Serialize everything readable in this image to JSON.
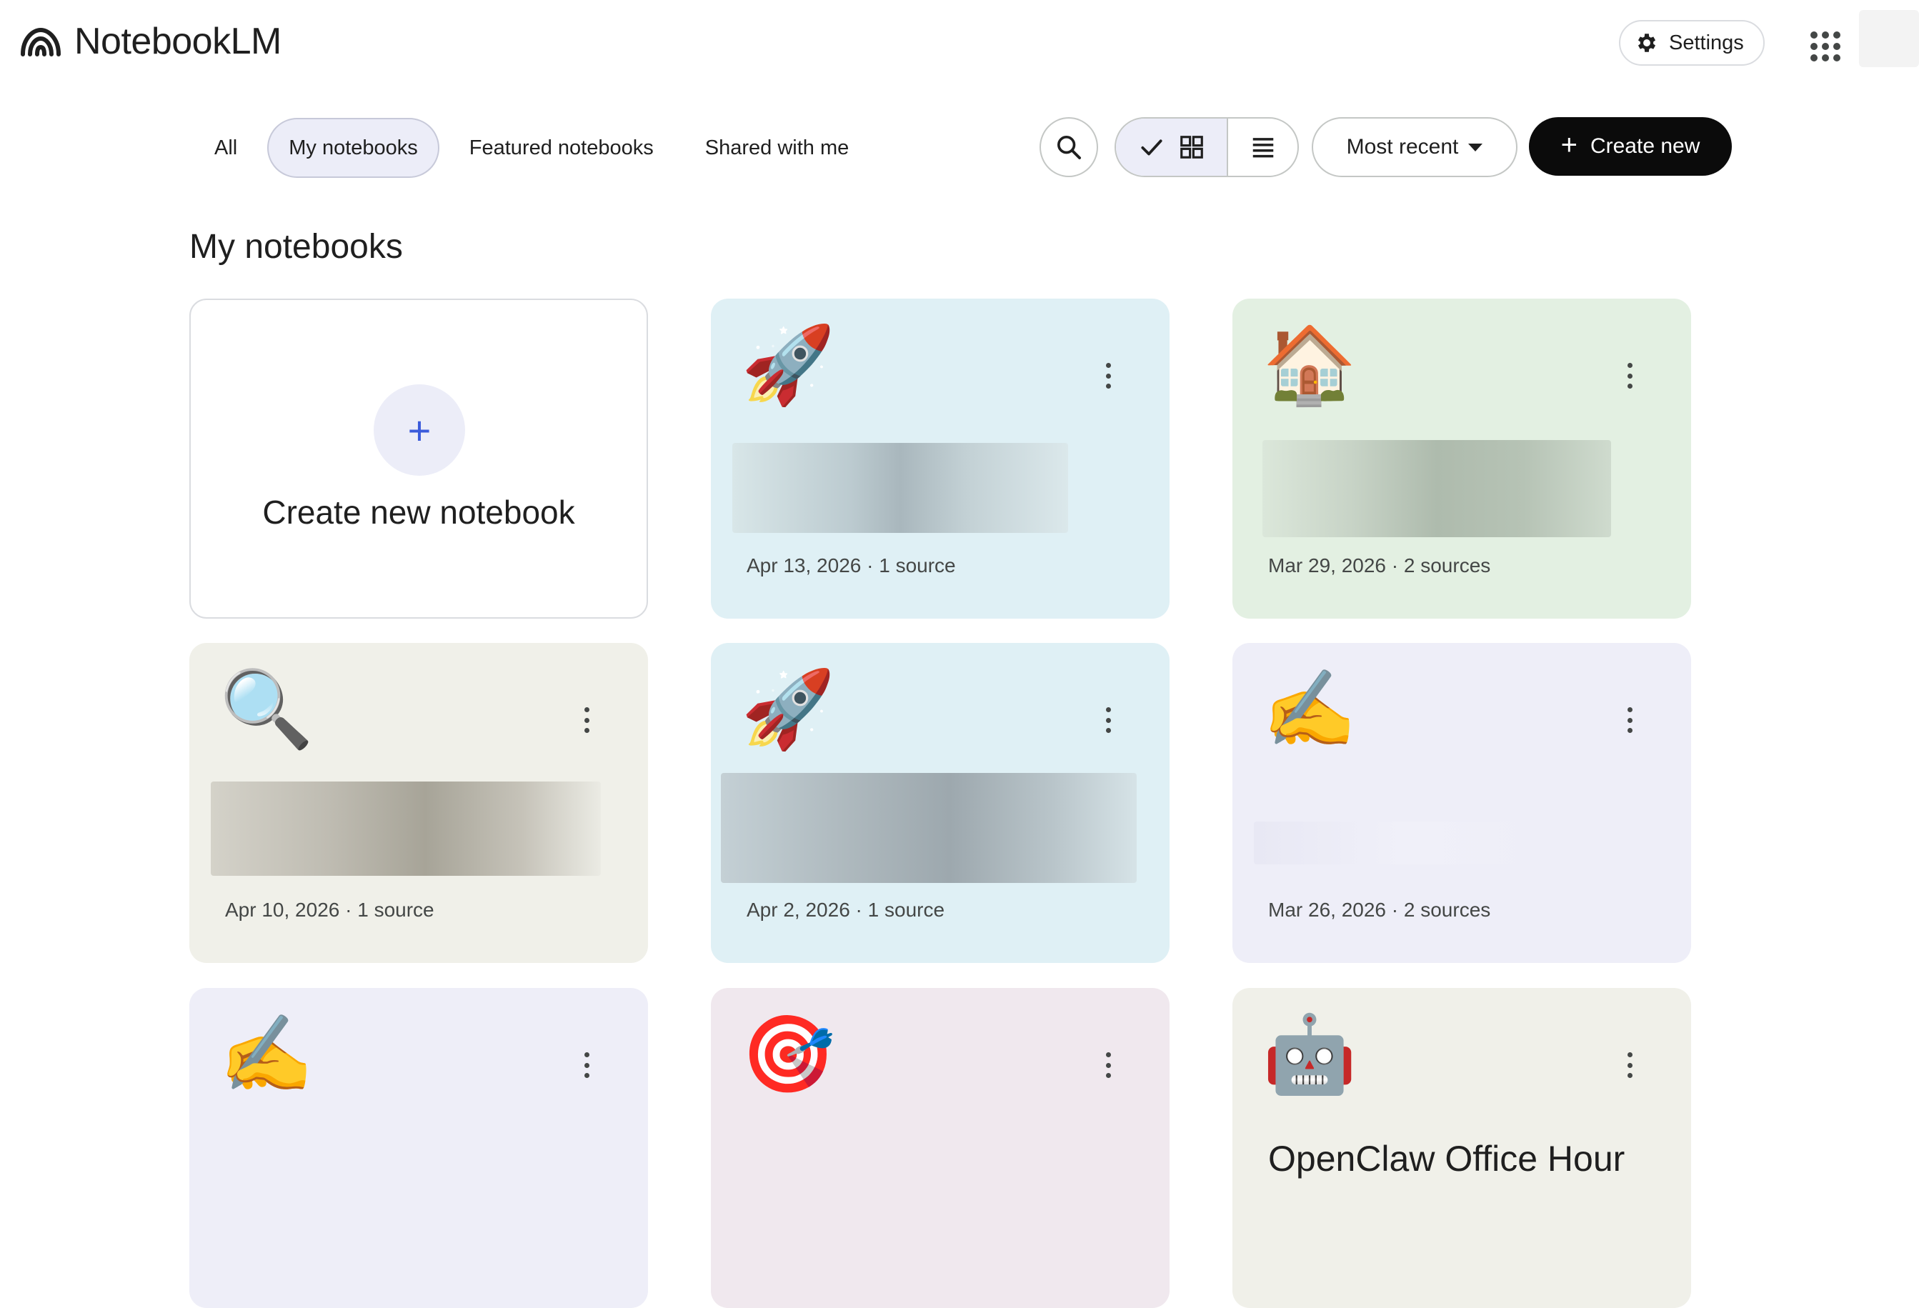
{
  "app": {
    "name": "NotebookLM",
    "settings_label": "Settings"
  },
  "filters": {
    "tabs": [
      "All",
      "My notebooks",
      "Featured notebooks",
      "Shared with me"
    ],
    "active": "My notebooks",
    "sort_label": "Most recent",
    "create_label": "Create new",
    "view": "grid"
  },
  "section_title": "My notebooks",
  "create_card_label": "Create new notebook",
  "notebooks": [
    {
      "emoji": "🚀",
      "title": "",
      "meta": "Apr 13, 2026 · 1 source",
      "color": "#dff0f5"
    },
    {
      "emoji": "🏠",
      "title": "",
      "meta": "Mar 29, 2026 · 2 sources",
      "color": "#e3f0e2"
    },
    {
      "emoji": "🔍",
      "title": "",
      "meta": "Apr 10, 2026 · 1 source",
      "color": "#f0f0e9"
    },
    {
      "emoji": "🚀",
      "title": "",
      "meta": "Apr 2, 2026 · 1 source",
      "color": "#dff0f5"
    },
    {
      "emoji": "✍️",
      "title": "",
      "meta": "Mar 26, 2026 · 2 sources",
      "color": "#eeeef8"
    },
    {
      "emoji": "✍️",
      "title": "",
      "meta": "",
      "color": "#eeeef8"
    },
    {
      "emoji": "🎯",
      "title": "",
      "meta": "",
      "color": "#f0e8ee"
    },
    {
      "emoji": "🤖",
      "title": "OpenClaw Office Hour",
      "meta": "",
      "color": "#f0f0e9"
    }
  ]
}
